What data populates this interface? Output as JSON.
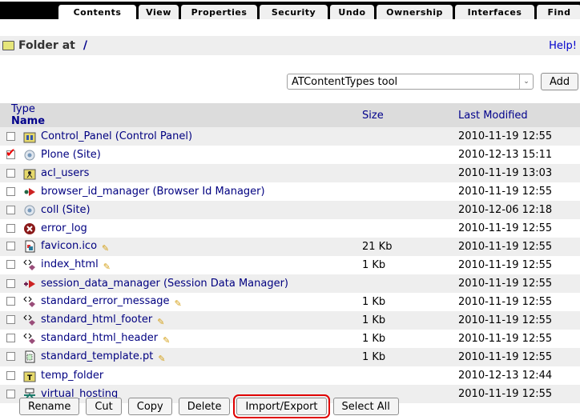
{
  "tabs": [
    {
      "label": "Contents",
      "active": true
    },
    {
      "label": "View"
    },
    {
      "label": "Properties"
    },
    {
      "label": "Security"
    },
    {
      "label": "Undo"
    },
    {
      "label": "Ownership"
    },
    {
      "label": "Interfaces"
    },
    {
      "label": "Find"
    }
  ],
  "header": {
    "title": "Folder at",
    "path": "/",
    "help": "Help!"
  },
  "add": {
    "selected": "ATContentTypes tool",
    "button": "Add"
  },
  "table": {
    "columns": {
      "type": "Type",
      "name": "Name",
      "size": "Size",
      "modified": "Last Modified"
    },
    "rows": [
      {
        "name": "Control_Panel (Control Panel)",
        "icon": "control-panel-icon",
        "size": "",
        "modified": "2010-11-19 12:55",
        "checked": false,
        "editable": false
      },
      {
        "name": "Plone (Site)",
        "icon": "site-icon",
        "size": "",
        "modified": "2010-12-13 15:11",
        "checked": true,
        "editable": false
      },
      {
        "name": "acl_users",
        "icon": "user-folder-icon",
        "size": "",
        "modified": "2010-11-19 13:03",
        "checked": false,
        "editable": false
      },
      {
        "name": "browser_id_manager (Browser Id Manager)",
        "icon": "browser-id-manager-icon",
        "size": "",
        "modified": "2010-11-19 12:55",
        "checked": false,
        "editable": false
      },
      {
        "name": "coll (Site)",
        "icon": "site-icon",
        "size": "",
        "modified": "2010-12-06 12:18",
        "checked": false,
        "editable": false
      },
      {
        "name": "error_log",
        "icon": "error-log-icon",
        "size": "",
        "modified": "2010-11-19 12:55",
        "checked": false,
        "editable": false
      },
      {
        "name": "favicon.ico",
        "icon": "image-icon",
        "size": "21 Kb",
        "modified": "2010-11-19 12:55",
        "checked": false,
        "editable": true
      },
      {
        "name": "index_html",
        "icon": "dtml-method-icon",
        "size": "1 Kb",
        "modified": "2010-11-19 12:55",
        "checked": false,
        "editable": true
      },
      {
        "name": "session_data_manager (Session Data Manager)",
        "icon": "session-data-manager-icon",
        "size": "",
        "modified": "2010-11-19 12:55",
        "checked": false,
        "editable": false
      },
      {
        "name": "standard_error_message",
        "icon": "dtml-method-icon",
        "size": "1 Kb",
        "modified": "2010-11-19 12:55",
        "checked": false,
        "editable": true
      },
      {
        "name": "standard_html_footer",
        "icon": "dtml-method-icon",
        "size": "1 Kb",
        "modified": "2010-11-19 12:55",
        "checked": false,
        "editable": true
      },
      {
        "name": "standard_html_header",
        "icon": "dtml-method-icon",
        "size": "1 Kb",
        "modified": "2010-11-19 12:55",
        "checked": false,
        "editable": true
      },
      {
        "name": "standard_template.pt",
        "icon": "page-template-icon",
        "size": "1 Kb",
        "modified": "2010-11-19 12:55",
        "checked": false,
        "editable": true
      },
      {
        "name": "temp_folder",
        "icon": "temp-folder-icon",
        "size": "",
        "modified": "2010-12-13 12:44",
        "checked": false,
        "editable": false
      },
      {
        "name": "virtual_hosting",
        "icon": "virtual-hosting-icon",
        "size": "",
        "modified": "2010-11-19 12:55",
        "checked": false,
        "editable": false
      }
    ]
  },
  "actions": [
    {
      "label": "Rename"
    },
    {
      "label": "Cut"
    },
    {
      "label": "Copy"
    },
    {
      "label": "Delete"
    },
    {
      "label": "Import/Export",
      "highlighted": true
    },
    {
      "label": "Select All"
    }
  ],
  "colors": {
    "link": "#000080",
    "highlight": "#e00000",
    "row_alt": "#eeeeee",
    "header_bg": "#dcdcdc"
  }
}
